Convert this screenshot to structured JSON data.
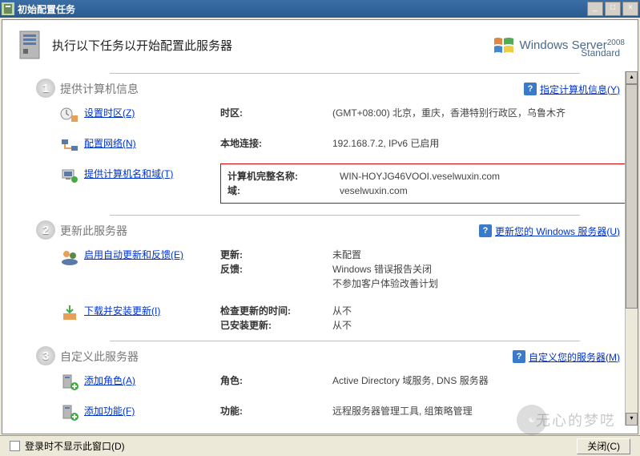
{
  "titlebar": {
    "title": "初始配置任务"
  },
  "header": {
    "text": "执行以下任务以开始配置此服务器",
    "brand": "Windows Server",
    "year": "2008",
    "sub": "Standard"
  },
  "sections": {
    "s1": {
      "num": "1",
      "title": "提供计算机信息",
      "help": "指定计算机信息(Y)"
    },
    "s2": {
      "num": "2",
      "title": "更新此服务器",
      "help": "更新您的 Windows 服务器(U)"
    },
    "s3": {
      "num": "3",
      "title": "自定义此服务器",
      "help": "自定义您的服务器(M)"
    }
  },
  "tasks": {
    "timezone": {
      "link": "设置时区(Z)",
      "label": "时区:",
      "value": "(GMT+08:00) 北京，重庆，香港特别行政区，乌鲁木齐"
    },
    "network": {
      "link": "配置网络(N)",
      "label": "本地连接:",
      "value": "192.168.7.2, IPv6 已启用"
    },
    "computer": {
      "link": "提供计算机名和域(T)",
      "label1": "计算机完整名称:",
      "value1": "WIN-HOYJG46VOOI.veselwuxin.com",
      "label2": "域:",
      "value2": "veselwuxin.com"
    },
    "updates": {
      "link": "启用自动更新和反馈(E)",
      "label1": "更新:",
      "value1": "未配置",
      "label2": "反馈:",
      "value2": "Windows 错误报告关闭",
      "value3": "不参加客户体验改善计划"
    },
    "download": {
      "link": "下载并安装更新(I)",
      "label1": "检查更新的时间:",
      "value1": "从不",
      "label2": "已安装更新:",
      "value2": "从不"
    },
    "roles": {
      "link": "添加角色(A)",
      "label": "角色:",
      "value": "Active Directory 域服务, DNS 服务器"
    },
    "features": {
      "link": "添加功能(F)",
      "label": "功能:",
      "value": "远程服务器管理工具, 组策略管理"
    }
  },
  "bottom": {
    "checkbox_label": "登录时不显示此窗口(D)",
    "close": "关闭(C)"
  },
  "watermark": "无心的梦呓"
}
